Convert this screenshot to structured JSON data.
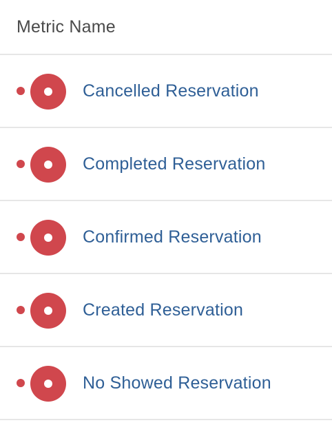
{
  "table": {
    "header": {
      "metric_name_label": "Metric Name"
    },
    "rows": [
      {
        "label": "Cancelled Reservation",
        "icon": "metric-record-icon"
      },
      {
        "label": "Completed Reservation",
        "icon": "metric-record-icon"
      },
      {
        "label": "Confirmed Reservation",
        "icon": "metric-record-icon"
      },
      {
        "label": "Created Reservation",
        "icon": "metric-record-icon"
      },
      {
        "label": "No Showed Reservation",
        "icon": "metric-record-icon"
      }
    ]
  },
  "colors": {
    "icon_red": "#d0474d",
    "link_blue": "#2f5f96",
    "header_text": "#4a4a4a",
    "divider": "#e6e6e6"
  }
}
